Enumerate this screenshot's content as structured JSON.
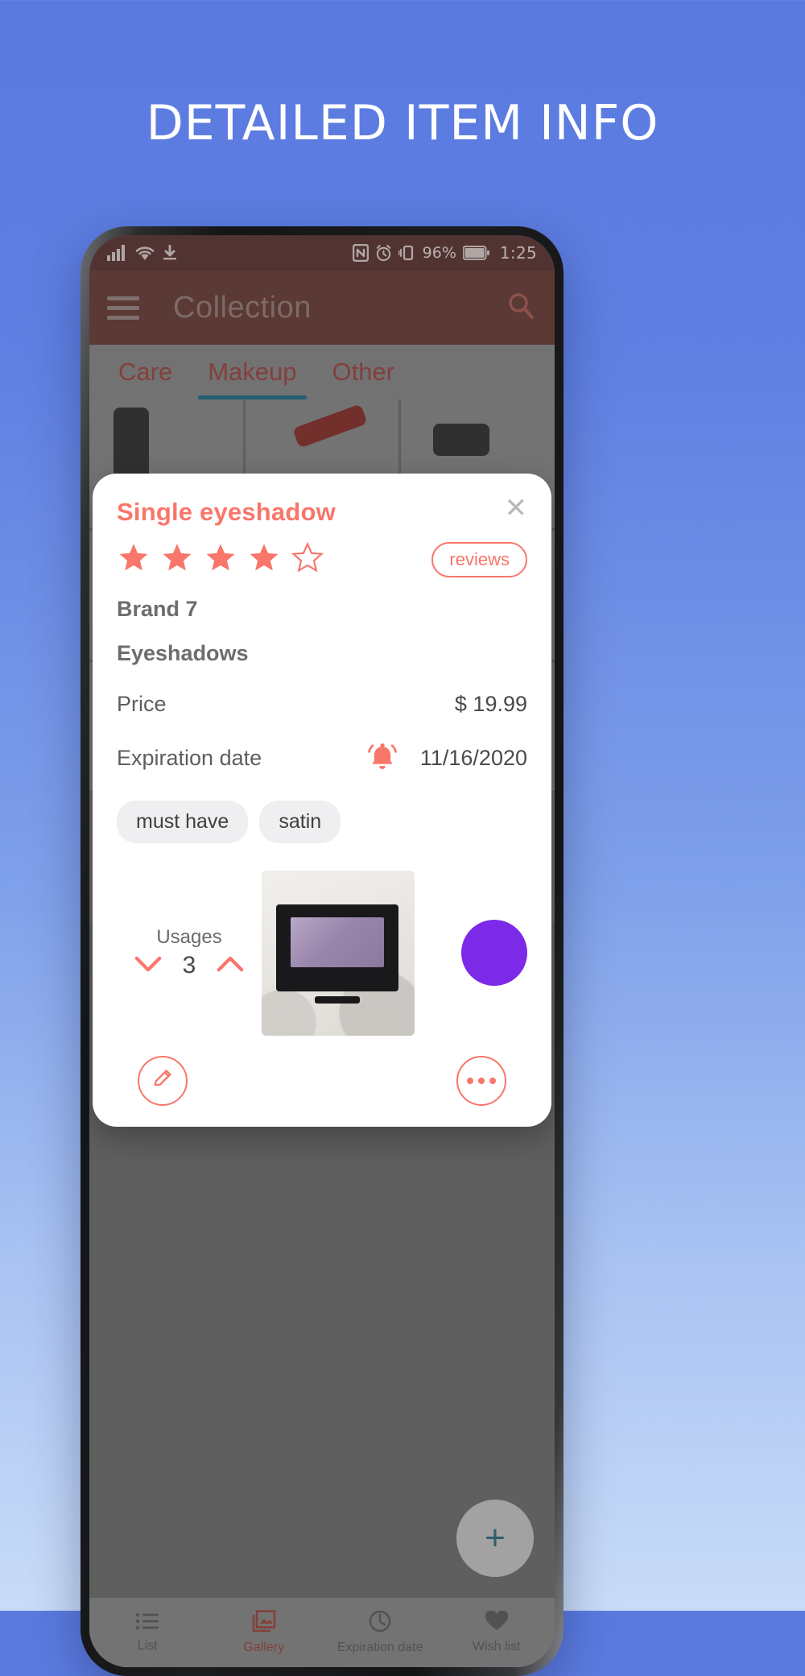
{
  "headline": "DETAILED ITEM INFO",
  "phone": {
    "statusbar": {
      "signal_icon": "cellular-signal-icon",
      "wifi_icon": "wifi-icon",
      "download_icon": "download-icon",
      "nfc_icon": "nfc-icon",
      "alarm_icon": "alarm-icon",
      "vibrate_icon": "vibrate-icon",
      "battery_percent": "96%",
      "battery_icon": "battery-icon",
      "time": "1:25"
    },
    "appbar": {
      "menu_icon": "hamburger-menu-icon",
      "title": "Collection",
      "search_icon": "search-icon"
    },
    "tabs": [
      {
        "label": "Care",
        "active": false
      },
      {
        "label": "Makeup",
        "active": true
      },
      {
        "label": "Other",
        "active": false
      }
    ],
    "fab": {
      "icon": "plus-icon",
      "label": "+"
    },
    "bottom_nav": [
      {
        "label": "List",
        "icon": "list-icon",
        "active": false
      },
      {
        "label": "Gallery",
        "icon": "gallery-icon",
        "active": true
      },
      {
        "label": "Expiration date",
        "icon": "clock-icon",
        "active": false
      },
      {
        "label": "Wish list",
        "icon": "heart-icon",
        "active": false
      }
    ]
  },
  "dialog": {
    "title": "Single eyeshadow",
    "close_icon": "close-icon",
    "rating": {
      "value": 4,
      "max": 5,
      "star_icon": "star-icon"
    },
    "reviews_label": "reviews",
    "brand": "Brand 7",
    "category": "Eyeshadows",
    "rows": [
      {
        "label": "Price",
        "value": "$ 19.99",
        "icon": ""
      },
      {
        "label": "Expiration date",
        "value": "11/16/2020",
        "icon": "alarm-bell-icon"
      }
    ],
    "tags": [
      "must have",
      "satin"
    ],
    "usages": {
      "label": "Usages",
      "count": "3",
      "decrement_icon": "chevron-down-icon",
      "increment_icon": "chevron-up-icon"
    },
    "thumbnail_icon": "product-photo",
    "color_swatch": "#7c2ae8",
    "edit_button_icon": "pencil-icon",
    "more_button_icon": "more-dots-icon"
  },
  "colors": {
    "accent": "#f8766a",
    "appbar": "#693833",
    "statusbar": "#5b322f",
    "tab_text": "#a2433b",
    "tab_indicator": "#1d6d8c",
    "background_top": "#5a7ae0",
    "background_bottom": "#c9dcf8"
  }
}
